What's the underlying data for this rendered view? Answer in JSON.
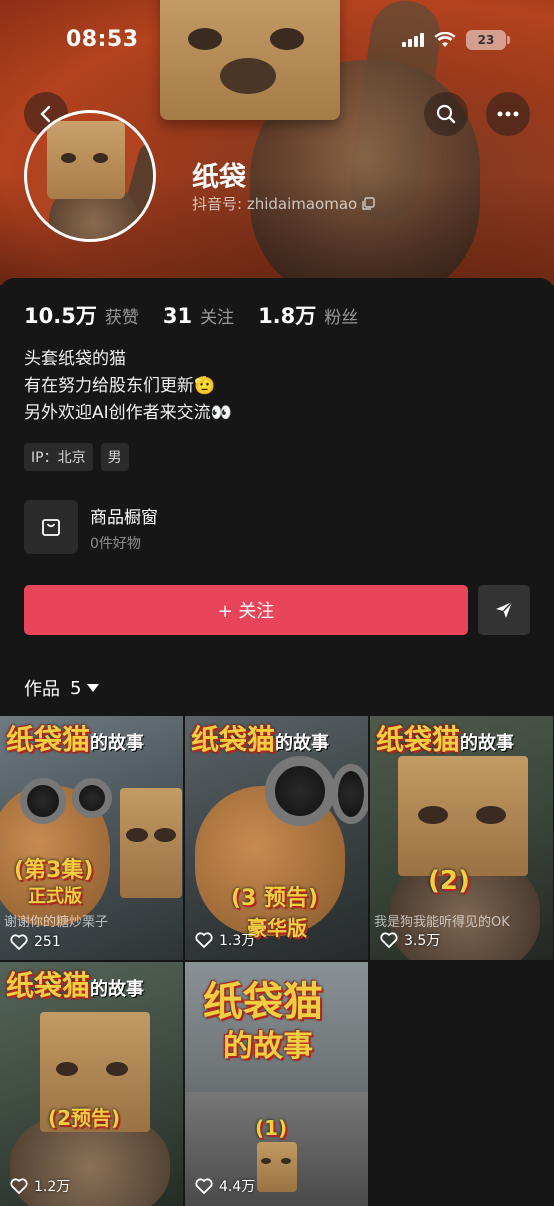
{
  "status_bar": {
    "time": "08:53",
    "battery": "23"
  },
  "profile": {
    "nickname": "纸袋",
    "douyin_id_label": "抖音号: zhidaimaomao",
    "stats": [
      {
        "value": "10.5万",
        "label": "获赞"
      },
      {
        "value": "31",
        "label": "关注"
      },
      {
        "value": "1.8万",
        "label": "粉丝"
      }
    ],
    "bio": [
      "头套纸袋的猫",
      "有在努力给股东们更新🫡",
      "另外欢迎AI创作者来交流👀"
    ],
    "tags": [
      "IP：北京",
      "男"
    ]
  },
  "shop": {
    "title": "商品橱窗",
    "subtitle": "0件好物"
  },
  "actions": {
    "follow_label": "+ 关注"
  },
  "works_tab": {
    "label": "作品",
    "count": "5"
  },
  "videos": [
    {
      "title": "纸袋猫",
      "title_suffix": "的故事",
      "badge": "(第3集)",
      "badge2": "正式版",
      "caption": "谢谢你的糖炒栗子",
      "likes": "251"
    },
    {
      "title": "纸袋猫",
      "title_suffix": "的故事",
      "badge": "(3 预告)",
      "badge2": "豪华版",
      "caption": "",
      "likes": "1.3万"
    },
    {
      "title": "纸袋猫",
      "title_suffix": "的故事",
      "badge": "(2)",
      "badge2": "",
      "caption": "我是狗我能听得见的OK",
      "likes": "3.5万"
    },
    {
      "title": "纸袋猫",
      "title_suffix": "的故事",
      "badge": "(2预告)",
      "badge2": "",
      "caption": "",
      "likes": "1.2万"
    },
    {
      "title": "纸袋猫",
      "title_suffix": "的故事",
      "badge": "(1)",
      "badge2": "",
      "caption": "",
      "likes": "4.4万"
    }
  ],
  "colors": {
    "accent": "#e8445a",
    "banner": "#b4421f",
    "background": "#161616"
  },
  "icons": [
    "back-icon",
    "search-icon",
    "more-icon",
    "copy-icon",
    "shop-bag-icon",
    "share-send-icon",
    "chevron-down-icon",
    "heart-icon"
  ]
}
